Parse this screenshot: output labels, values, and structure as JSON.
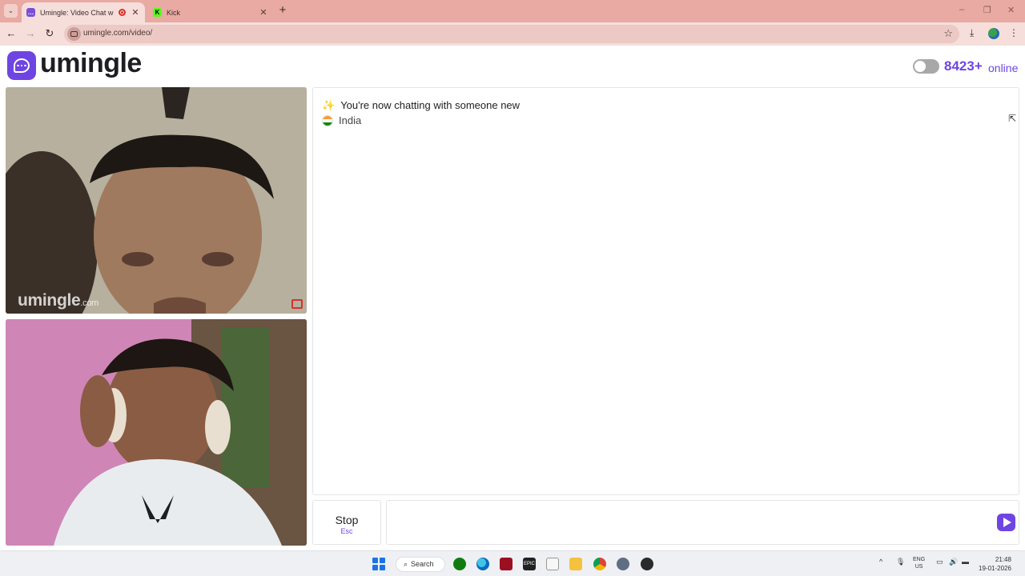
{
  "browser": {
    "tabs": [
      {
        "title": "Umingle: Video Chat with S",
        "favicon": "umingle-chat-icon",
        "active": true,
        "recording": true
      },
      {
        "title": "Kick",
        "favicon": "kick-icon",
        "active": false
      }
    ],
    "new_tab_symbol": "+",
    "url": "umingle.com/video/",
    "window_controls": {
      "minimize": "–",
      "restore": "❐",
      "close": "✕"
    }
  },
  "header": {
    "logo_text": "umingle",
    "online_count": "8423+",
    "online_label": "online"
  },
  "videos": {
    "stranger_watermark": "umingle",
    "stranger_watermark_suffix": ".com"
  },
  "chat": {
    "system_message": "You're now chatting with someone new",
    "spark_icon": "✨",
    "country": "India",
    "input_placeholder": ""
  },
  "controls": {
    "stop_label": "Stop",
    "stop_shortcut": "Esc"
  },
  "taskbar": {
    "search_label": "Search",
    "language": "ENG",
    "region": "US",
    "time": "21:48",
    "date": "19-01-2026"
  },
  "colors": {
    "brand": "#6e45e2",
    "tabbar": "#e8aaa3",
    "addressbar": "#f6dedb"
  }
}
